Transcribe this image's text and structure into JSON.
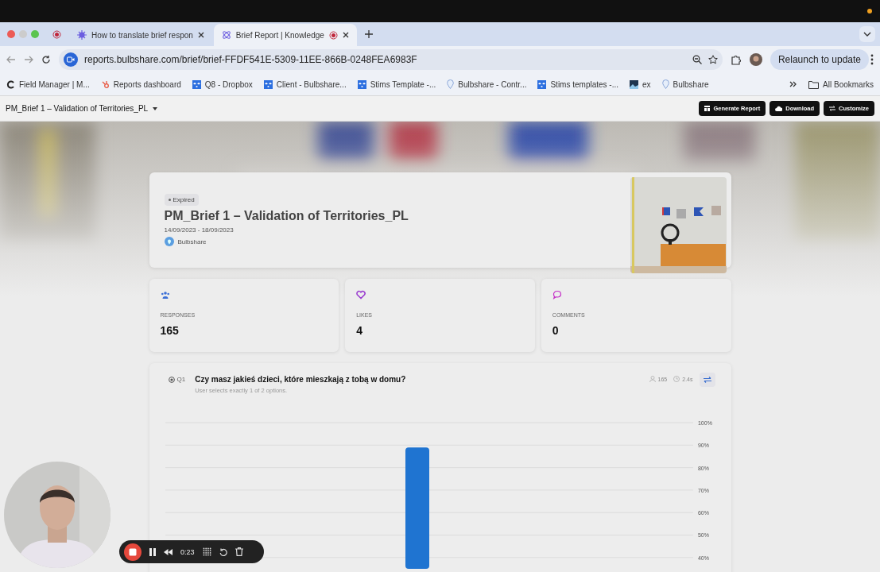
{
  "browser": {
    "tabs": [
      {
        "title": "How to translate brief respon",
        "selected": false,
        "recording": false
      },
      {
        "title": "Brief Report | Knowledge",
        "selected": true,
        "recording": true
      }
    ],
    "url": "reports.bulbshare.com/brief/brief-FFDF541E-5309-11EE-866B-0248FEA6983F",
    "relaunch": "Relaunch to update",
    "bookmarks": [
      {
        "label": "Field Manager | M..."
      },
      {
        "label": "Reports dashboard"
      },
      {
        "label": "Q8 - Dropbox"
      },
      {
        "label": "Client - Bulbshare..."
      },
      {
        "label": "Stims Template -..."
      },
      {
        "label": "Bulbshare - Contr..."
      },
      {
        "label": "Stims templates -..."
      },
      {
        "label": "ex"
      },
      {
        "label": "Bulbshare"
      }
    ],
    "all_bookmarks": "All Bookmarks"
  },
  "header": {
    "title": "PM_Brief 1 – Validation of Territories_PL",
    "buttons": [
      {
        "label": "Generate Report"
      },
      {
        "label": "Download"
      },
      {
        "label": "Customize"
      }
    ]
  },
  "brief": {
    "status": "Expired",
    "title": "PM_Brief 1 – Validation of Territories_PL",
    "dates": "14/09/2023 - 18/09/2023",
    "organization": "Bulbshare"
  },
  "stats": [
    {
      "kind": "responses",
      "label": "RESPONSES",
      "value": "165",
      "color": "#3b6fd6"
    },
    {
      "kind": "likes",
      "label": "LIKES",
      "value": "4",
      "color": "#9b3fd0"
    },
    {
      "kind": "comments",
      "label": "COMMENTS",
      "value": "0",
      "color": "#c42fc7"
    }
  ],
  "question": {
    "number": "Q1",
    "text": "Czy masz jakieś dzieci, które mieszkają z tobą w domu?",
    "hint": "User selects exactly 1 of 2 options.",
    "responses": "165",
    "time": "2.4s",
    "chart_data": {
      "type": "bar",
      "values": [
        89
      ],
      "ylim": [
        35,
        100
      ],
      "grid": true,
      "yticks": [
        {
          "value": 40,
          "label": "40%"
        },
        {
          "value": 50,
          "label": "50%"
        },
        {
          "value": 60,
          "label": "60%"
        },
        {
          "value": 70,
          "label": "70%"
        },
        {
          "value": 80,
          "label": "80%"
        },
        {
          "value": 90,
          "label": "90%"
        },
        {
          "value": 100,
          "label": "100%"
        }
      ]
    }
  },
  "recorder": {
    "time": "0:23"
  }
}
